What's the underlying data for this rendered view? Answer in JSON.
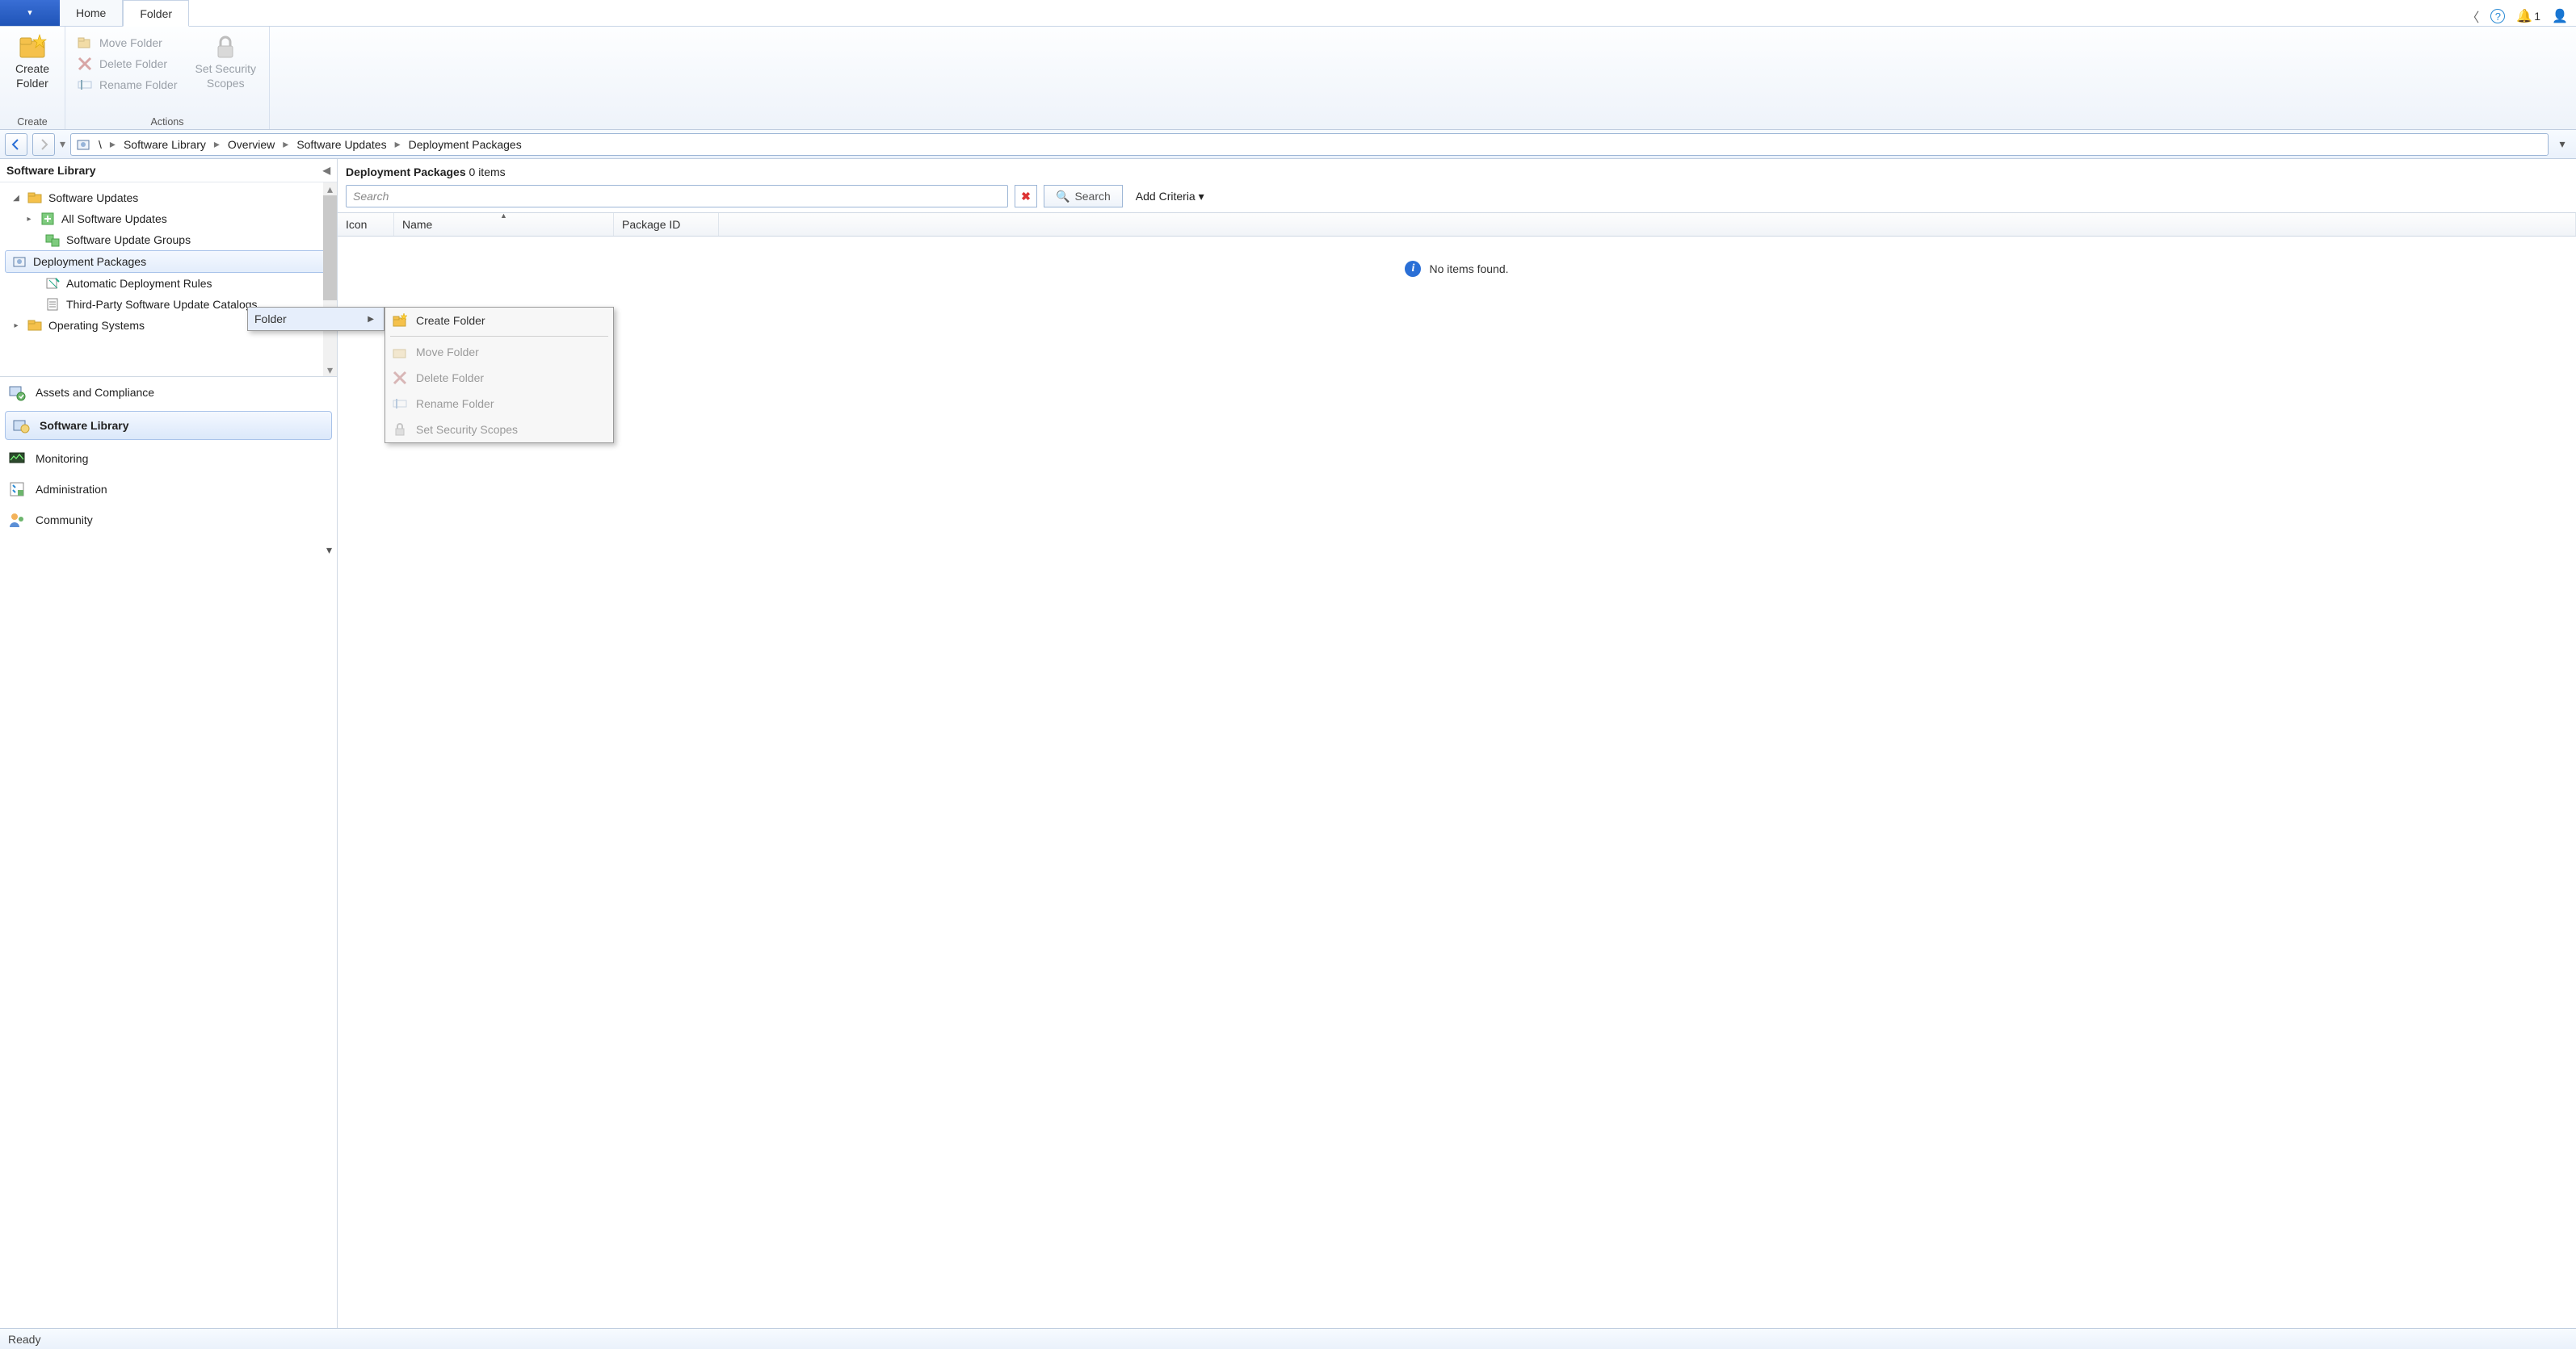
{
  "tabs": {
    "home": "Home",
    "folder": "Folder"
  },
  "titlebar": {
    "notif_count": "1"
  },
  "ribbon": {
    "create_folder_line1": "Create",
    "create_folder_line2": "Folder",
    "create_group": "Create",
    "move": "Move Folder",
    "delete": "Delete Folder",
    "rename": "Rename Folder",
    "scopes_line1": "Set Security",
    "scopes_line2": "Scopes",
    "actions_group": "Actions"
  },
  "breadcrumb": {
    "root": "\\",
    "c1": "Software Library",
    "c2": "Overview",
    "c3": "Software Updates",
    "c4": "Deployment Packages"
  },
  "left": {
    "title": "Software Library",
    "tree": {
      "su": "Software Updates",
      "all": "All Software Updates",
      "groups": "Software Update Groups",
      "deploy": "Deployment Packages",
      "adr": "Automatic Deployment Rules",
      "thirdparty": "Third-Party Software Update Catalogs",
      "os": "Operating Systems"
    },
    "wnav": {
      "assets": "Assets and Compliance",
      "library": "Software Library",
      "monitoring": "Monitoring",
      "admin": "Administration",
      "community": "Community"
    }
  },
  "main": {
    "title": "Deployment Packages",
    "count_suffix": "0 items",
    "search_placeholder": "Search",
    "search_btn": "Search",
    "add_criteria": "Add Criteria",
    "cols": {
      "icon": "Icon",
      "name": "Name",
      "pkg": "Package ID"
    },
    "empty": "No items found."
  },
  "ctx1": {
    "folder": "Folder"
  },
  "ctx2": {
    "create": "Create Folder",
    "move": "Move Folder",
    "delete": "Delete Folder",
    "rename": "Rename Folder",
    "scopes": "Set Security Scopes"
  },
  "status": {
    "text": "Ready"
  }
}
